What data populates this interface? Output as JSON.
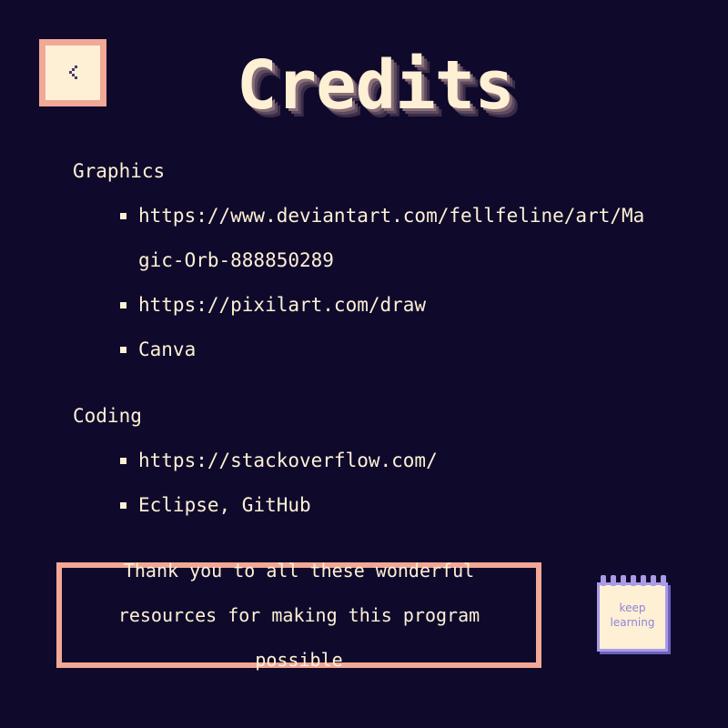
{
  "header": {
    "title": "Credits",
    "back_icon": "chevron-left-icon"
  },
  "colors": {
    "background": "#0f0a2b",
    "text": "#fdf0d5",
    "accent_border": "#f2a896",
    "notepad_accent": "#a99be6"
  },
  "sections": {
    "graphics": {
      "heading": "Graphics",
      "items": [
        "https://www.deviantart.com/fellfeline/art/Magic-Orb-888850289",
        "https://pixilart.com/draw",
        "Canva"
      ]
    },
    "coding": {
      "heading": "Coding",
      "items": [
        "https://stackoverflow.com/",
        "Eclipse, GitHub"
      ]
    }
  },
  "footer": {
    "thanks_message": "Thank you to all these wonderful resources for making this program possible"
  },
  "notepad": {
    "line1": "keep",
    "line2": "learning",
    "icon": "notepad-icon"
  }
}
